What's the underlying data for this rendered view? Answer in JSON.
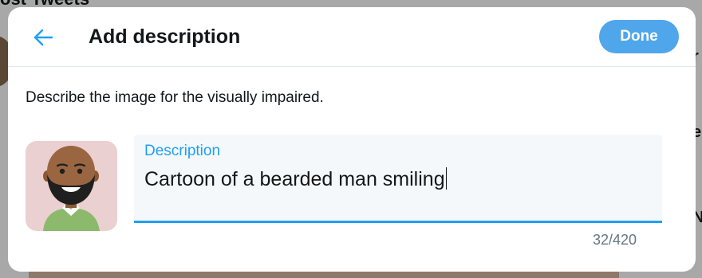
{
  "background": {
    "heading_fragment": "ost Tweets"
  },
  "modal": {
    "back_icon": "arrow-left-icon",
    "title": "Add description",
    "done_label": "Done",
    "instructions": "Describe the image for the visually impaired.",
    "description_label": "Description",
    "description_value": "Cartoon of a bearded man smiling",
    "char_count": "32/420",
    "accent_color": "#1da1f2",
    "done_color": "#50a6ea"
  }
}
